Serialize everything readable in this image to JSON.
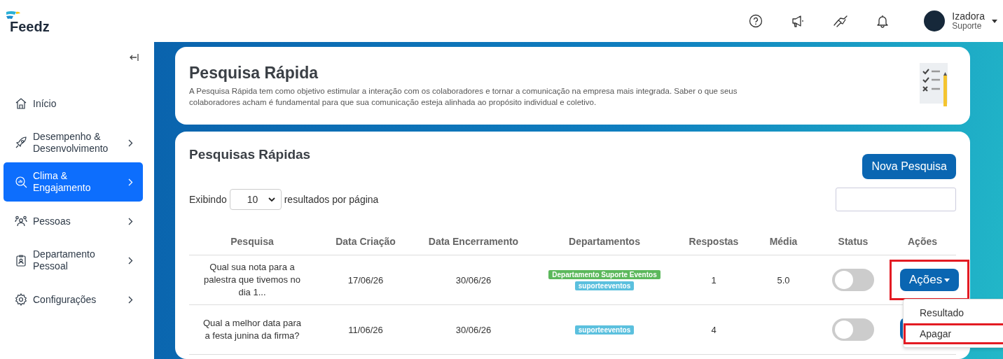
{
  "brand": {
    "name": "Feedz"
  },
  "header": {
    "user": {
      "name": "Izadora",
      "role": "Suporte"
    }
  },
  "sidebar": {
    "items": [
      {
        "label": "Início",
        "selected": false,
        "submenu": false
      },
      {
        "label": "Desempenho & Desenvolvimento",
        "selected": false,
        "submenu": true
      },
      {
        "label": "Clima & Engajamento",
        "selected": true,
        "submenu": true
      },
      {
        "label": "Pessoas",
        "selected": false,
        "submenu": true
      },
      {
        "label": "Departamento Pessoal",
        "selected": false,
        "submenu": true
      },
      {
        "label": "Configurações",
        "selected": false,
        "submenu": true
      }
    ]
  },
  "intro": {
    "title": "Pesquisa Rápida",
    "description": "A Pesquisa Rápida tem como objetivo estimular a interação com os colaboradores e tornar a comunicação na empresa mais integrada. Saber o que seus colaboradores acham é fundamental para que sua comunicação esteja alinhada ao propósito individual e coletivo."
  },
  "list": {
    "title": "Pesquisas Rápidas",
    "new_button": "Nova Pesquisa",
    "length": {
      "before": "Exibindo",
      "value": "10",
      "after": "resultados por página"
    },
    "columns": [
      "Pesquisa",
      "Data Criação",
      "Data Encerramento",
      "Departamentos",
      "Respostas",
      "Média",
      "Status",
      "Ações"
    ],
    "rows": [
      {
        "pesquisa": "Qual sua nota para a palestra que tivemos no dia 1...",
        "created": "17/06/26",
        "closes": "30/06/26",
        "departments": [
          {
            "label": "Departamento Suporte Eventos",
            "color": "#5cb85c"
          },
          {
            "label": "suporteeventos",
            "color": "#5bc0de"
          }
        ],
        "responses": "1",
        "average": "5.0",
        "on": false,
        "action": {
          "label": "Ações",
          "highlighted": true
        },
        "menu": [
          {
            "label": "Resultado",
            "highlighted": false
          },
          {
            "label": "Apagar",
            "highlighted": true
          }
        ]
      },
      {
        "pesquisa": "Qual a melhor data para a festa junina da firma?",
        "created": "11/06/26",
        "closes": "30/06/26",
        "departments": [
          {
            "label": "suporteeventos",
            "color": "#5bc0de"
          }
        ],
        "responses": "4",
        "on": false,
        "action": {
          "highlighted": false
        }
      }
    ]
  }
}
